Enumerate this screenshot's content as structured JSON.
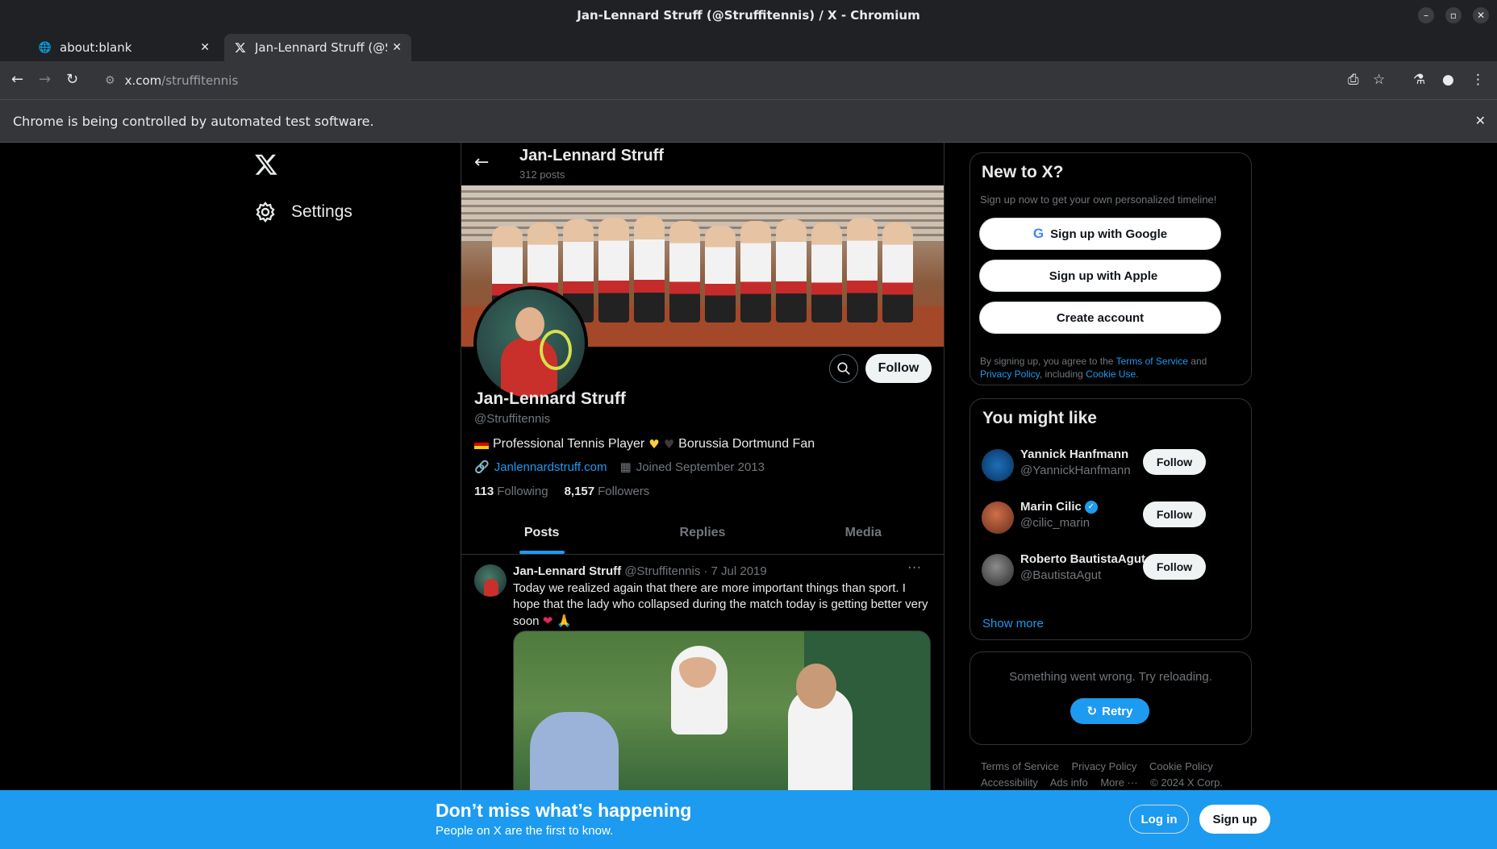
{
  "window": {
    "title": "Jan-Lennard Struff (@Struffitennis) / X - Chromium",
    "controls": [
      "minimize",
      "maximize",
      "close"
    ]
  },
  "tabs": [
    {
      "label": "about:blank",
      "icon": "globe-icon",
      "active": false
    },
    {
      "label": "Jan-Lennard Struff (@St",
      "icon": "x-logo-icon",
      "active": true
    }
  ],
  "toolbar": {
    "url_host": "x.com",
    "url_path": "/struffitennis"
  },
  "infobar": {
    "text": "Chrome is being controlled by automated test software."
  },
  "sidebar": {
    "settings_label": "Settings"
  },
  "profile": {
    "header_name": "Jan-Lennard Struff",
    "post_count": "312 posts",
    "name": "Jan-Lennard Struff",
    "handle": "@Struffitennis",
    "bio_text": "Professional Tennis Player",
    "bio_text2": "Borussia Dortmund Fan",
    "website": "Janlennardstruff.com",
    "joined": "Joined September 2013",
    "following_count": "113",
    "following_label": "Following",
    "followers_count": "8,157",
    "followers_label": "Followers",
    "follow_label": "Follow"
  },
  "profile_tabs": [
    "Posts",
    "Replies",
    "Media"
  ],
  "post": {
    "author": "Jan-Lennard Struff",
    "handle": "@Struffitennis",
    "date": "· 7 Jul 2019",
    "text": "Today we realized again that there are more important things than sport. I hope that the lady who collapsed during the match today is getting better very soon",
    "text_suffix": "❤ 🙏"
  },
  "new_to_x": {
    "title": "New to X?",
    "subtitle": "Sign up now to get your own personalized timeline!",
    "google_label": "Sign up with Google",
    "apple_label": "Sign up with Apple",
    "create_label": "Create account",
    "legal_prefix": "By signing up, you agree to the",
    "terms_link": "Terms of Service",
    "legal_and": "and",
    "privacy_link": "Privacy Policy",
    "legal_including": ", including",
    "cookie_link": "Cookie Use."
  },
  "you_might_like": {
    "title": "You might like",
    "people": [
      {
        "name": "Yannick Hanfmann",
        "handle": "@YannickHanfmann",
        "verified": false,
        "follow": "Follow"
      },
      {
        "name": "Marin Cilic",
        "handle": "@cilic_marin",
        "verified": true,
        "follow": "Follow"
      },
      {
        "name": "Roberto BautistaAgut",
        "handle": "@BautistaAgut",
        "verified": false,
        "follow": "Follow"
      }
    ],
    "show_more": "Show more"
  },
  "error_card": {
    "message": "Something went wrong. Try reloading.",
    "retry": "Retry"
  },
  "footer": {
    "links": [
      "Terms of Service",
      "Privacy Policy",
      "Cookie Policy",
      "Accessibility",
      "Ads info",
      "More ···",
      "© 2024 X Corp."
    ]
  },
  "bottom_bar": {
    "headline": "Don’t miss what’s happening",
    "subline": "People on X are the first to know.",
    "login": "Log in",
    "signup": "Sign up"
  },
  "colors": {
    "accent": "#1d9bf0",
    "background": "#000000",
    "chrome_dark": "#202124"
  }
}
